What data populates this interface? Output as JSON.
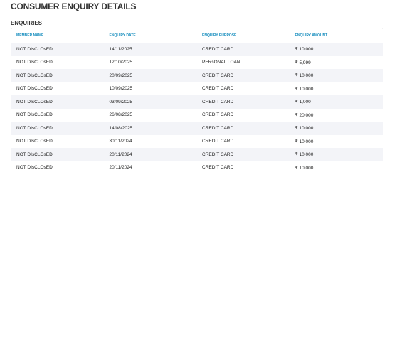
{
  "page_title": "CONSUMER ENQUIRY DETAILS",
  "section_title": "ENQUIRIES",
  "table": {
    "headers": [
      "MEMBER NAME",
      "ENQUIRY DATE",
      "ENQUIRY PURPOSE",
      "ENQUIRY AMOUNT"
    ],
    "rows": [
      [
        "NOT DIsCLOsED",
        "14/11/2025",
        "CREDIT CARD",
        "₹ 10,000"
      ],
      [
        "NOT DIsCLOsED",
        "12/10/2025",
        "PERsONAL LOAN",
        "₹ 5,999"
      ],
      [
        "NOT DIsCLOsED",
        "20/09/2025",
        "CREDIT CARD",
        "₹ 10,000"
      ],
      [
        "NOT DIsCLOsED",
        "10/09/2025",
        "CREDIT CARD",
        "₹ 10,000"
      ],
      [
        "NOT DIsCLOsED",
        "03/09/2025",
        "CREDIT CARD",
        "₹ 1,000"
      ],
      [
        "NOT DIsCLOsED",
        "26/08/2025",
        "CREDIT CARD",
        "₹ 20,000"
      ],
      [
        "NOT DIsCLOsED",
        "14/08/2025",
        "CREDIT CARD",
        "₹ 10,000"
      ],
      [
        "NOT DIsCLOsED",
        "30/11/2024",
        "CREDIT CARD",
        "₹ 10,000"
      ],
      [
        "NOT DIsCLOsED",
        "20/11/2024",
        "CREDIT CARD",
        "₹ 10,000"
      ],
      [
        "NOT DIsCLOsED",
        "20/11/2024",
        "CREDIT CARD",
        "₹ 10,000"
      ]
    ]
  },
  "colors": {
    "header_text": "#1a8fbf",
    "row_stripe": "#f3f4f8",
    "border": "#c8c8c8"
  }
}
